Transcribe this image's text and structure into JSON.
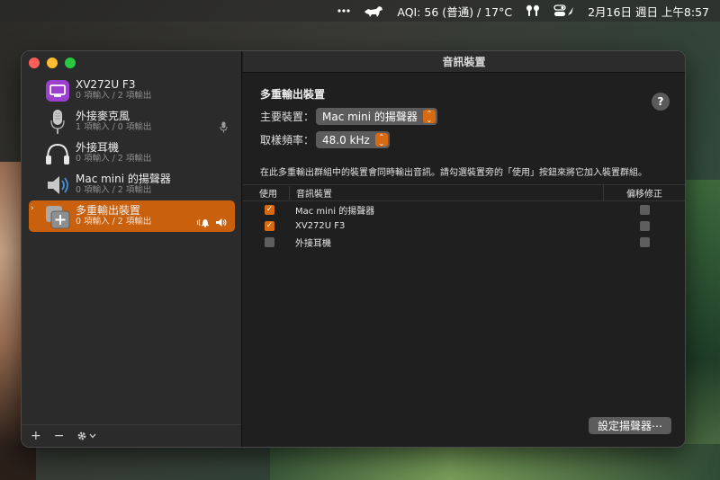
{
  "menubar": {
    "aqi": "AQI: 56 (普通) / 17°C",
    "datetime": "2月16日 週日 上午8:57"
  },
  "window": {
    "title": "音訊裝置"
  },
  "devices": [
    {
      "name": "XV272U F3",
      "sub": "0 項輸入 / 2 項輸出",
      "icon": "monitor-icon"
    },
    {
      "name": "外接麥克風",
      "sub": "1 項輸入 / 0 項輸出",
      "icon": "microphone-icon"
    },
    {
      "name": "外接耳機",
      "sub": "0 項輸入 / 2 項輸出",
      "icon": "headphones-icon"
    },
    {
      "name": "Mac mini 的揚聲器",
      "sub": "0 項輸入 / 2 項輸出",
      "icon": "speaker-icon"
    },
    {
      "name": "多重輸出裝置",
      "sub": "0 項輸入 / 2 項輸出",
      "icon": "multi-output-icon",
      "selected": true
    }
  ],
  "sidebar_footer": {
    "add": "+",
    "remove": "−"
  },
  "main": {
    "section_title": "多重輸出裝置",
    "primary_label": "主要裝置：",
    "primary_value": "Mac mini 的揚聲器",
    "rate_label": "取樣頻率：",
    "rate_value": "48.0 kHz",
    "description": "在此多重輸出群組中的裝置會同時輸出音訊。請勾選裝置旁的「使用」按鈕來將它加入裝置群組。",
    "help": "?"
  },
  "table": {
    "headers": {
      "use": "使用",
      "device": "音訊裝置",
      "drift": "偏移修正"
    },
    "rows": [
      {
        "device": "Mac mini 的揚聲器",
        "use": true,
        "drift": false
      },
      {
        "device": "XV272U F3",
        "use": true,
        "drift": false
      },
      {
        "device": "外接耳機",
        "use": false,
        "drift": false
      }
    ]
  },
  "buttons": {
    "configure": "設定揚聲器⋯"
  },
  "colors": {
    "accent": "#c8600e",
    "checkbox_on": "#d86b12"
  }
}
